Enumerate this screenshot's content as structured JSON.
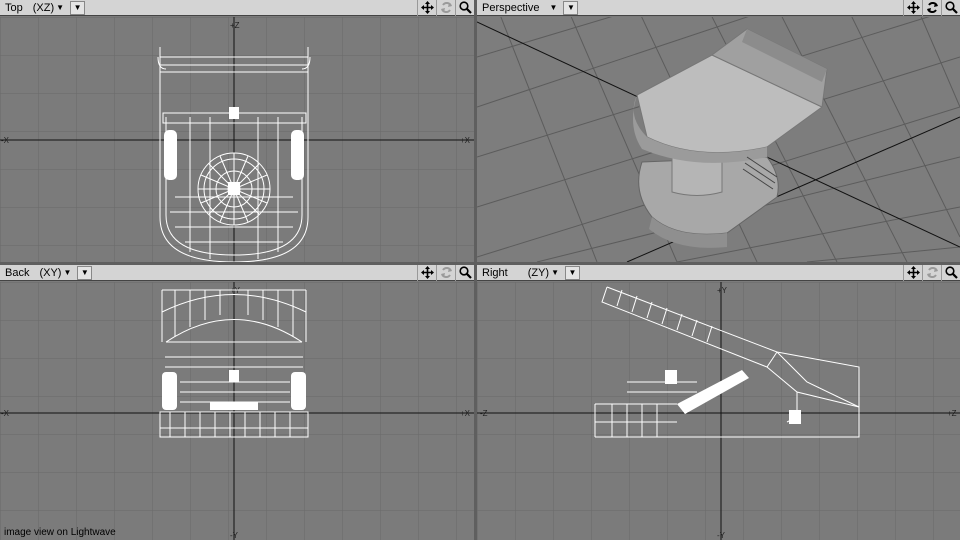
{
  "viewports": {
    "top": {
      "title": "Top",
      "axis": "(XZ)"
    },
    "perspective": {
      "title": "Perspective",
      "axis": ""
    },
    "back": {
      "title": "Back",
      "axis": "(XY)"
    },
    "right": {
      "title": "Right",
      "axis": "(ZY)"
    }
  },
  "axes": {
    "top": {
      "up": "+Z",
      "right": "+X",
      "left": "-X"
    },
    "back": {
      "up": "+Y",
      "right": "+X",
      "left": "-X",
      "down": "-Y"
    },
    "right": {
      "up": "+Y",
      "right": "+Z",
      "left": "-Z",
      "down": "-Y"
    }
  },
  "icons": {
    "move": "move-view-icon",
    "rotate": "rotate-view-icon",
    "zoom": "zoom-view-icon"
  },
  "caption": "image view on Lightwave",
  "colors": {
    "viewport_bg": "#7b7b7b",
    "grid": "#666666",
    "wire": "#ffffff",
    "header": "#d4d4d4"
  }
}
